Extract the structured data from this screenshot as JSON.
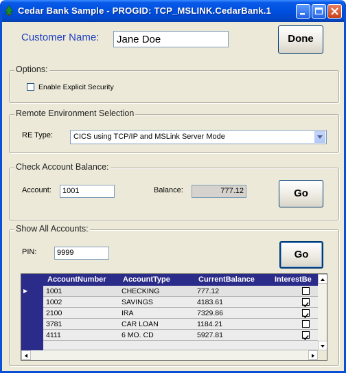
{
  "window": {
    "title": "Cedar Bank Sample - PROGID: TCP_MSLINK.CedarBank.1",
    "icon": "tree-icon"
  },
  "customer": {
    "label": "Customer Name:",
    "value": "Jane Doe",
    "label_color": "#1f3fbf"
  },
  "done_button": "Done",
  "options": {
    "title": "Options:",
    "explicit_security_label": "Enable Explicit Security",
    "explicit_security_checked": false
  },
  "remote": {
    "title": "Remote Environment Selection",
    "re_type_label": "RE Type:",
    "re_type_value": "CICS using TCP/IP and MSLink Server Mode"
  },
  "balance": {
    "title": "Check Account Balance:",
    "account_label": "Account:",
    "account_value": "1001",
    "balance_label": "Balance:",
    "balance_value": "777.12",
    "go_label": "Go"
  },
  "all_accounts": {
    "title": "Show All Accounts:",
    "pin_label": "PIN:",
    "pin_value": "9999",
    "go_label": "Go",
    "columns": [
      "AccountNumber",
      "AccountType",
      "CurrentBalance",
      "InterestBe"
    ],
    "rows": [
      {
        "number": "1001",
        "type": "CHECKING",
        "balance": "777.12",
        "interest": false
      },
      {
        "number": "1002",
        "type": "SAVINGS",
        "balance": "4183.61",
        "interest": true
      },
      {
        "number": "2100",
        "type": "IRA",
        "balance": "7329.86",
        "interest": true
      },
      {
        "number": "3781",
        "type": "CAR LOAN",
        "balance": "1184.21",
        "interest": false
      },
      {
        "number": "4111",
        "type": "6 MO. CD",
        "balance": "5927.81",
        "interest": true
      }
    ],
    "current_row_marker": "▶"
  }
}
